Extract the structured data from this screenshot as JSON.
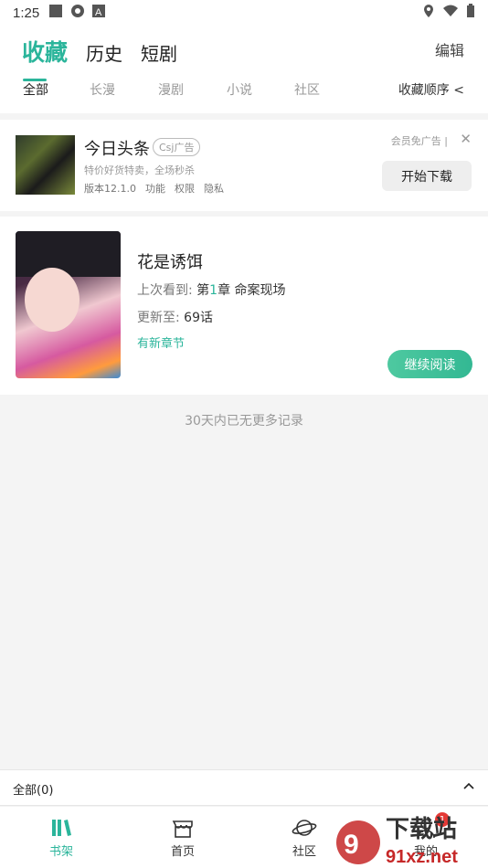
{
  "status": {
    "time": "1:25"
  },
  "header": {
    "tabs": [
      "收藏",
      "历史",
      "短剧"
    ],
    "edit_label": "编辑",
    "sub_tabs": [
      "全部",
      "长漫",
      "漫剧",
      "小说",
      "社区"
    ],
    "sort_label": "收藏顺序 <"
  },
  "ad": {
    "title": "今日头条",
    "badge": "Csj广告",
    "desc": "特价好货特卖，全场秒杀",
    "version": "版本12.1.0",
    "links": [
      "功能",
      "权限",
      "隐私"
    ],
    "vip_label": "会员免广告 |",
    "close_icon": "✕",
    "download_label": "开始下载"
  },
  "book": {
    "title": "花是诱饵",
    "last_read_prefix": "上次看到: ",
    "last_read_di": "第",
    "last_read_num": "1",
    "last_read_rest": "章 命案现场",
    "update_prefix": "更新至: ",
    "update_value": "69话",
    "new_chapter": "有新章节",
    "continue_label": "继续阅读"
  },
  "no_more": "30天内已无更多记录",
  "filter": {
    "label": "全部(0)",
    "chevron": "^"
  },
  "nav": {
    "items": [
      {
        "label": "书架",
        "icon": "bookshelf-icon",
        "active": true
      },
      {
        "label": "首页",
        "icon": "home-store-icon"
      },
      {
        "label": "社区",
        "icon": "planet-icon"
      },
      {
        "label": "我的",
        "icon": "profile-icon"
      }
    ],
    "badge": "1"
  },
  "colors": {
    "accent": "#2bb59b",
    "badge": "#e53935"
  }
}
